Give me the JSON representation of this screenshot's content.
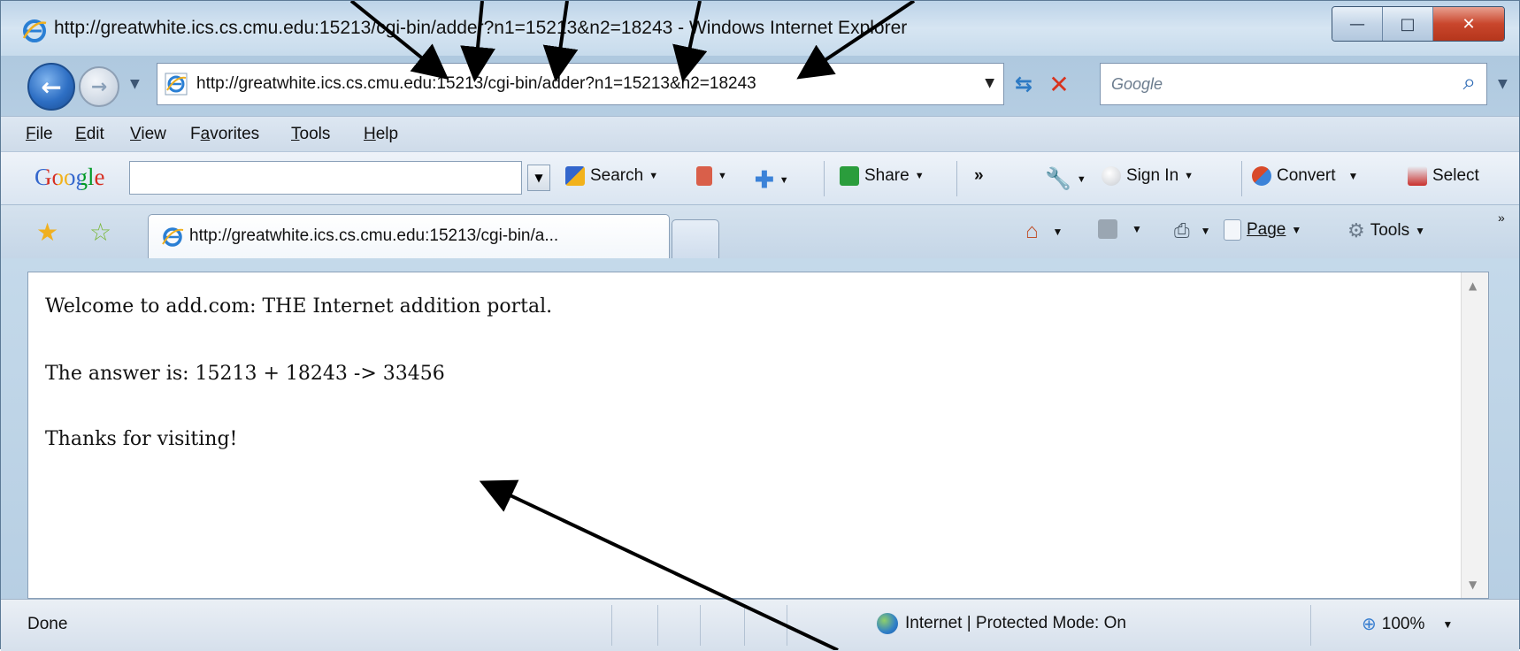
{
  "window": {
    "title": "http://greatwhite.ics.cs.cmu.edu:15213/cgi-bin/adder?n1=15213&n2=18243 - Windows Internet Explorer"
  },
  "address_bar": {
    "url": "http://greatwhite.ics.cs.cmu.edu:15213/cgi-bin/adder?n1=15213&n2=18243"
  },
  "search_box": {
    "placeholder": "Google"
  },
  "menu": {
    "items": [
      {
        "label": "File",
        "key": "F",
        "rest": "ile"
      },
      {
        "label": "Edit",
        "key": "E",
        "rest": "dit"
      },
      {
        "label": "View",
        "key": "V",
        "rest": "iew"
      },
      {
        "label": "Favorites",
        "pre": "F",
        "key": "a",
        "rest": "vorites"
      },
      {
        "label": "Tools",
        "key": "T",
        "rest": "ools"
      },
      {
        "label": "Help",
        "key": "H",
        "rest": "elp"
      }
    ]
  },
  "google_toolbar": {
    "logo": "Google",
    "search_label": "Search",
    "share_label": "Share",
    "more_label": "»",
    "signin_label": "Sign In",
    "convert_label": "Convert",
    "select_label": "Select"
  },
  "tab": {
    "title": "http://greatwhite.ics.cs.cmu.edu:15213/cgi-bin/a..."
  },
  "command_bar": {
    "page_label": "Page",
    "tools_label": "Tools",
    "overflow": "»"
  },
  "content": {
    "lines": [
      "Welcome to add.com: THE Internet addition portal.",
      "The answer is: 15213 + 18243 -> 33456",
      "Thanks for visiting!"
    ]
  },
  "status": {
    "text": "Done",
    "zone": "Internet | Protected Mode: On",
    "zoom": "100%"
  },
  "colors": {
    "google_blue": "#3366cc",
    "google_red": "#d62d20",
    "google_yellow": "#f2b21b",
    "google_green": "#009925"
  }
}
